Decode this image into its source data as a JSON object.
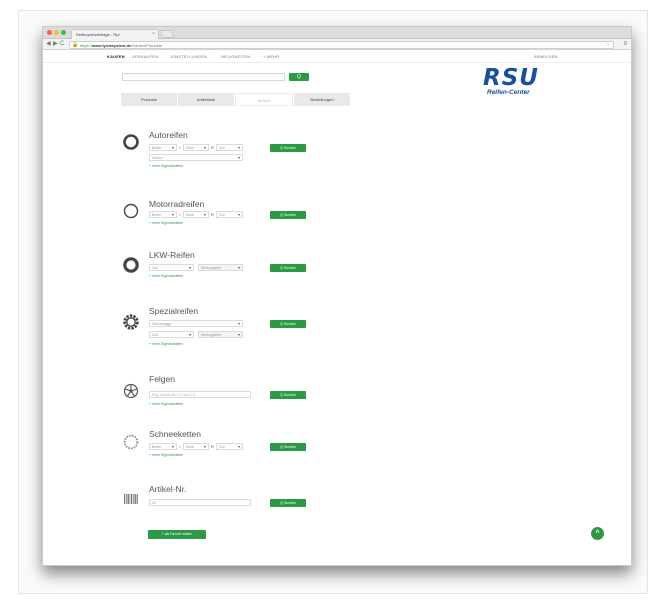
{
  "browser": {
    "tab_title": "Reifenpreisabfrage - Rpr",
    "tab_close": "×",
    "url_lock": "🔒",
    "url_scheme": "https://",
    "url_host": "www.lyreasystem.de",
    "url_path": "/Kaufen/Produkte",
    "star": "☆",
    "back": "◀",
    "forward": "▶",
    "reload": "C",
    "menu": "≡",
    "traffic_colors": [
      "#ff5f57",
      "#febc2e",
      "#28c840"
    ]
  },
  "site_nav": {
    "items": [
      "KAUFEN",
      "VERKAUFEN",
      "EINSTELLUNGEN",
      "NEUIGKEITEN",
      "+ MEHR"
    ],
    "active_index": 0,
    "login": "ABMELDEN"
  },
  "search": {
    "placeholder": "",
    "button_icon": "Q"
  },
  "logo": {
    "text": "RSU",
    "subtitle": "Reifen-Center",
    "color": "#1a4fa0"
  },
  "category_tabs": [
    "Produkte",
    "Artikelliste",
    "Bericht",
    "Bestellungen"
  ],
  "category_active_index": 2,
  "accent_color": "#2c9a45",
  "sections": {
    "autoreifen": {
      "title": "Autoreifen",
      "width": "Breite",
      "sep1": "/",
      "height": "Serie",
      "sep2": "R",
      "zoll": "Zoll",
      "season": "Saison",
      "search_label": "Q Suchen",
      "more": "+ mehr Eigenschaften"
    },
    "motorradreifen": {
      "title": "Motorradreifen",
      "width": "Breite",
      "sep1": "/",
      "height": "Serie",
      "sep2": "R",
      "zoll": "Zoll",
      "search_label": "Q Suchen",
      "more": "+ mehr Eigenschaften"
    },
    "lkw": {
      "title": "LKW-Reifen",
      "zoll": "Zoll",
      "load": "Stellungsfele",
      "search_label": "Q Suchen",
      "more": "+ mehr Eigenschaften"
    },
    "spezial": {
      "title": "Spezialreifen",
      "type": "Fahrzeugtyp",
      "zoll": "Zoll",
      "load": "Stellungsfele",
      "search_label": "Q Suchen",
      "more": "+ mehr Eigenschaften"
    },
    "felgen": {
      "title": "Felgen",
      "placeholder": "Fzg.-Schein-Nr. 2.2 und 2.3",
      "search_label": "Q Suchen",
      "more": "+ mehr Eigenschaften"
    },
    "schneeketten": {
      "title": "Schneeketten",
      "width": "Breite",
      "sep1": "/",
      "height": "Serie",
      "sep2": "R",
      "zoll": "Zoll",
      "search_label": "Q Suchen",
      "more": "+ mehr Eigenschaften"
    },
    "artikel": {
      "title": "Artikel-Nr.",
      "placeholder": "Nr.",
      "search_label": "Q Suchen"
    }
  },
  "add_button": "+ als Favorit nutzen",
  "scroll_top": "^"
}
